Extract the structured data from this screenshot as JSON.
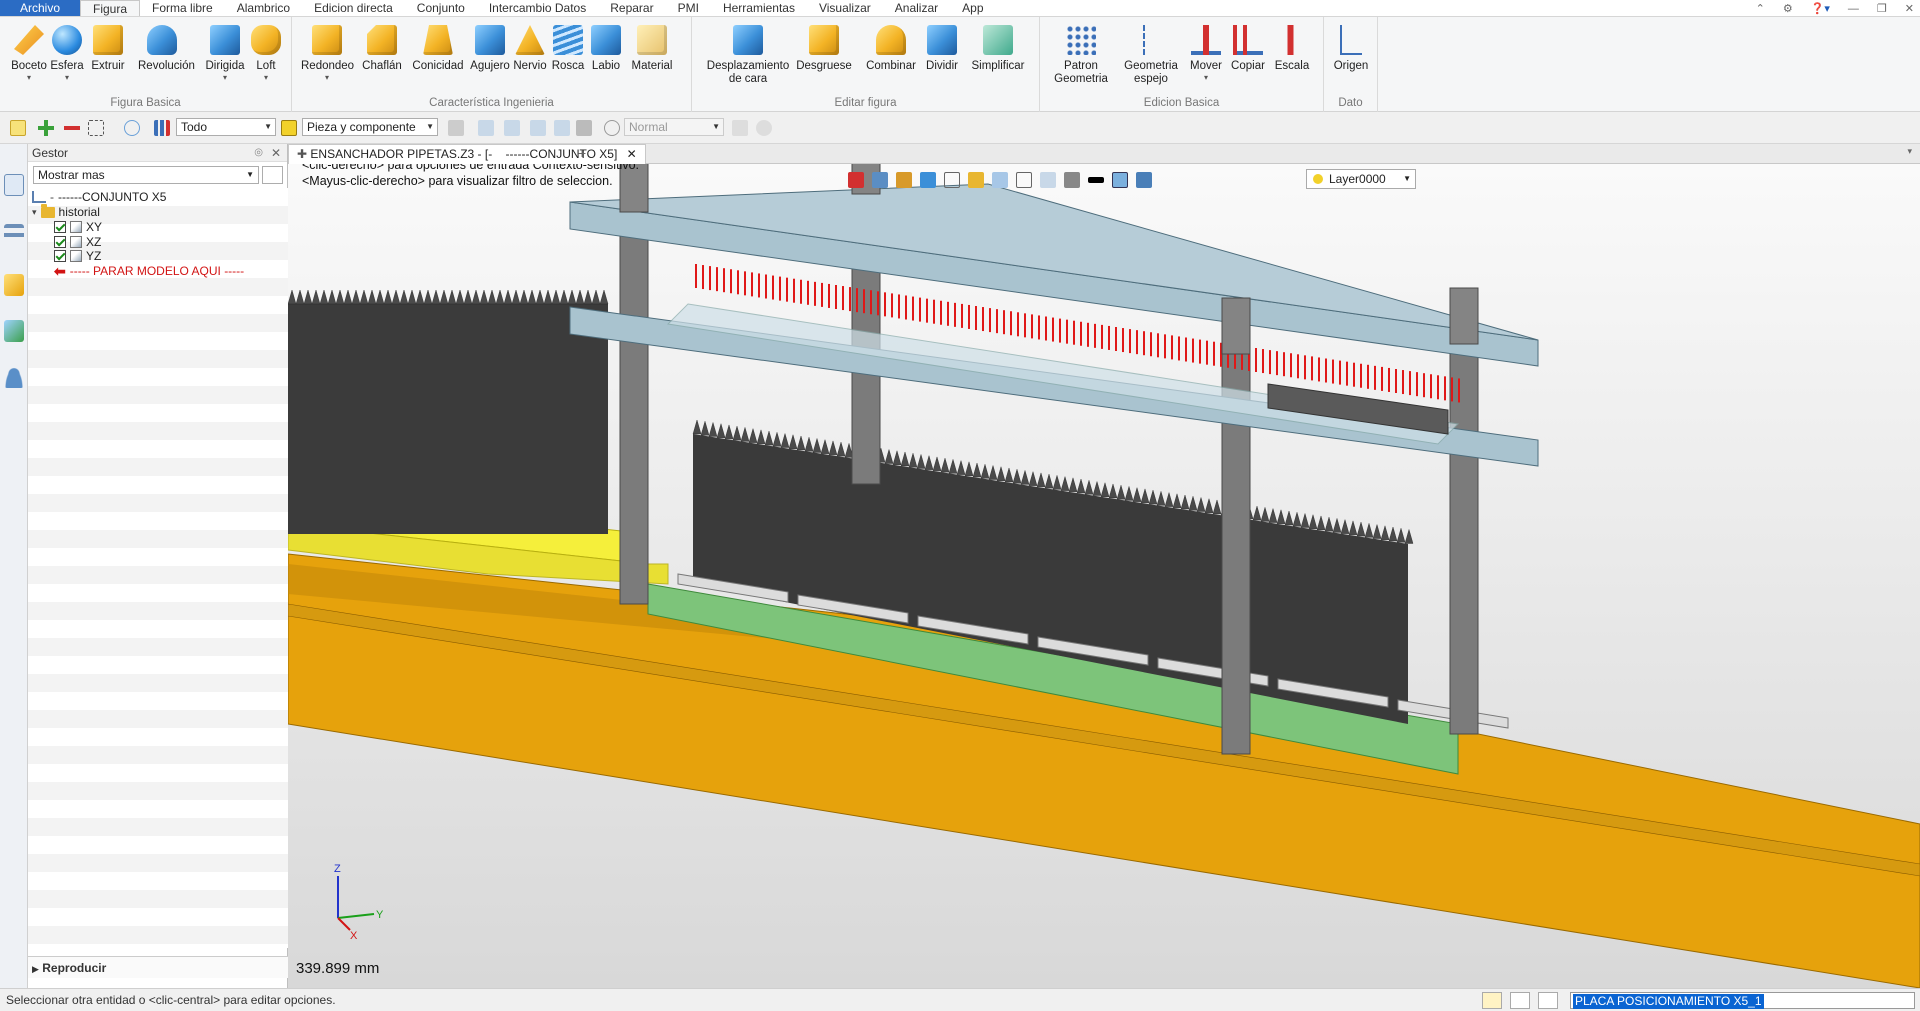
{
  "menubar": {
    "items": [
      "Archivo",
      "Figura",
      "Forma libre",
      "Alambrico",
      "Edicion directa",
      "Conjunto",
      "Intercambio Datos",
      "Reparar",
      "PMI",
      "Herramientas",
      "Visualizar",
      "Analizar",
      "App"
    ],
    "active": "Figura"
  },
  "ribbon": {
    "groups": [
      {
        "title": "Figura Basica",
        "buttons": [
          {
            "label": "Boceto",
            "icon": "sketch-icon",
            "dropdown": true
          },
          {
            "label": "Esfera",
            "icon": "sphere-icon",
            "dropdown": true
          },
          {
            "label": "Extruir",
            "icon": "extrude-icon",
            "dropdown": false
          },
          {
            "label": "Revolución",
            "icon": "revolve-icon",
            "dropdown": false
          },
          {
            "label": "Dirigida",
            "icon": "sweep-icon",
            "dropdown": true
          },
          {
            "label": "Loft",
            "icon": "loft-icon",
            "dropdown": true
          }
        ]
      },
      {
        "title": "Característica Ingenieria",
        "buttons": [
          {
            "label": "Redondeo",
            "icon": "fillet-icon",
            "dropdown": true
          },
          {
            "label": "Chaflán",
            "icon": "chamfer-icon",
            "dropdown": false
          },
          {
            "label": "Conicidad",
            "icon": "draft-icon",
            "dropdown": false
          },
          {
            "label": "Agujero",
            "icon": "hole-icon",
            "dropdown": false
          },
          {
            "label": "Nervio",
            "icon": "rib-icon",
            "dropdown": false
          },
          {
            "label": "Rosca",
            "icon": "thread-icon",
            "dropdown": false
          },
          {
            "label": "Labio",
            "icon": "lip-icon",
            "dropdown": false
          },
          {
            "label": "Material",
            "icon": "material-icon",
            "dropdown": false
          }
        ]
      },
      {
        "title": "Editar figura",
        "buttons": [
          {
            "label": "Desplazamiento de cara",
            "icon": "offset-face-icon",
            "dropdown": true
          },
          {
            "label": "Desgruese",
            "icon": "shell-icon",
            "dropdown": false
          },
          {
            "label": "Combinar",
            "icon": "combine-icon",
            "dropdown": false
          },
          {
            "label": "Dividir",
            "icon": "split-icon",
            "dropdown": false
          },
          {
            "label": "Simplificar",
            "icon": "simplify-icon",
            "dropdown": false
          }
        ]
      },
      {
        "title": "Edicion Basica",
        "buttons": [
          {
            "label": "Patron Geometria",
            "icon": "pattern-icon",
            "dropdown": true
          },
          {
            "label": "Geometria espejo",
            "icon": "mirror-icon",
            "dropdown": true
          },
          {
            "label": "Mover",
            "icon": "move-icon",
            "dropdown": true
          },
          {
            "label": "Copiar",
            "icon": "copy-icon",
            "dropdown": false
          },
          {
            "label": "Escala",
            "icon": "scale-icon",
            "dropdown": false
          }
        ]
      },
      {
        "title": "Dato",
        "buttons": [
          {
            "label": "Origen",
            "icon": "origin-icon",
            "dropdown": false
          }
        ]
      }
    ]
  },
  "toolbar2": {
    "filter_value": "Todo",
    "pick_value": "Pieza y componente",
    "mode_value": "Normal"
  },
  "manager": {
    "title": "Gestor",
    "filter": "Mostrar mas",
    "tree": {
      "root": "------CONJUNTO X5",
      "history": "historial",
      "planes": [
        "XY",
        "XZ",
        "YZ"
      ],
      "stop_marker": "----- PARAR MODELO AQUI -----"
    },
    "playback": "Reproducir"
  },
  "document": {
    "tab": "ENSANCHADOR PIPETAS.Z3 - [-    ------CONJUNTO X5]"
  },
  "viewport": {
    "hint_line1": "<clic-derecho> para opciones de entrada Contexto-sensitivo.",
    "hint_line2": "<Mayus-clic-derecho> para visualizar filtro de seleccion.",
    "layer": "Layer0000",
    "measure": "339.899 mm",
    "axis_z": "Z",
    "axis_x": "X",
    "axis_y": "Y"
  },
  "statusbar": {
    "text": "Seleccionar otra entidad o <clic-central> para editar opciones.",
    "selection": "PLACA POSICIONAMIENTO X5_1"
  },
  "colors": {
    "accent": "#2b6cc4",
    "plate": "#a9c3cf",
    "base": "#e6a20c",
    "green_plate": "#7dc47a",
    "yellow_part": "#f5ef3b",
    "pin": "#e01818"
  }
}
